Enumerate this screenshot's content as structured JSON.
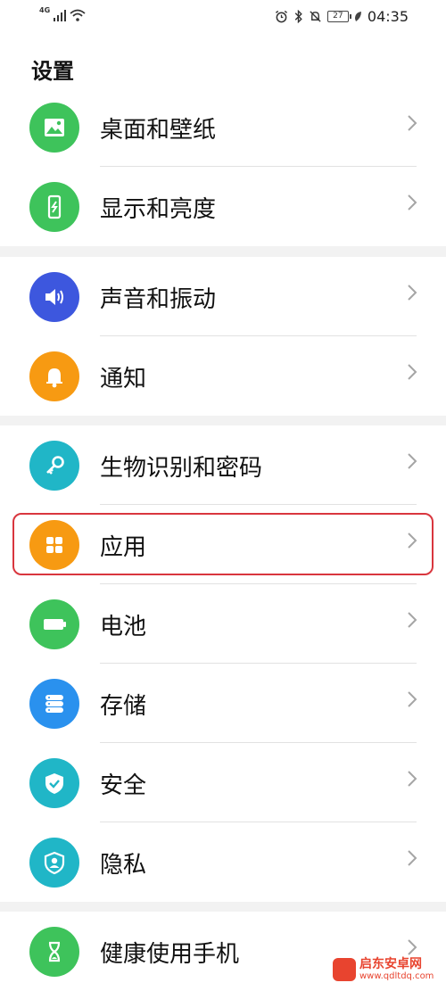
{
  "status_bar": {
    "network_label": "4G",
    "battery_level": "27",
    "time": "04:35"
  },
  "header": {
    "title": "设置"
  },
  "groups": [
    {
      "items": [
        {
          "label": "桌面和壁纸",
          "icon": "wallpaper-icon",
          "color": "#3ec35b"
        },
        {
          "label": "显示和亮度",
          "icon": "display-icon",
          "color": "#3ec35b"
        }
      ]
    },
    {
      "items": [
        {
          "label": "声音和振动",
          "icon": "sound-icon",
          "color": "#3d57de"
        },
        {
          "label": "通知",
          "icon": "bell-icon",
          "color": "#f79a12"
        }
      ]
    },
    {
      "items": [
        {
          "label": "生物识别和密码",
          "icon": "key-icon",
          "color": "#20b6c7"
        },
        {
          "label": "应用",
          "icon": "apps-icon",
          "color": "#f79a12",
          "highlighted": true
        },
        {
          "label": "电池",
          "icon": "battery-icon",
          "color": "#3ec35b"
        },
        {
          "label": "存储",
          "icon": "storage-icon",
          "color": "#2a91ee"
        },
        {
          "label": "安全",
          "icon": "shield-icon",
          "color": "#20b6c7"
        },
        {
          "label": "隐私",
          "icon": "privacy-icon",
          "color": "#20b6c7"
        }
      ]
    },
    {
      "items": [
        {
          "label": "健康使用手机",
          "icon": "hourglass-icon",
          "color": "#3ec35b"
        }
      ]
    }
  ],
  "watermark": {
    "name": "启东安卓网",
    "url": "www.qdltdq.com"
  }
}
